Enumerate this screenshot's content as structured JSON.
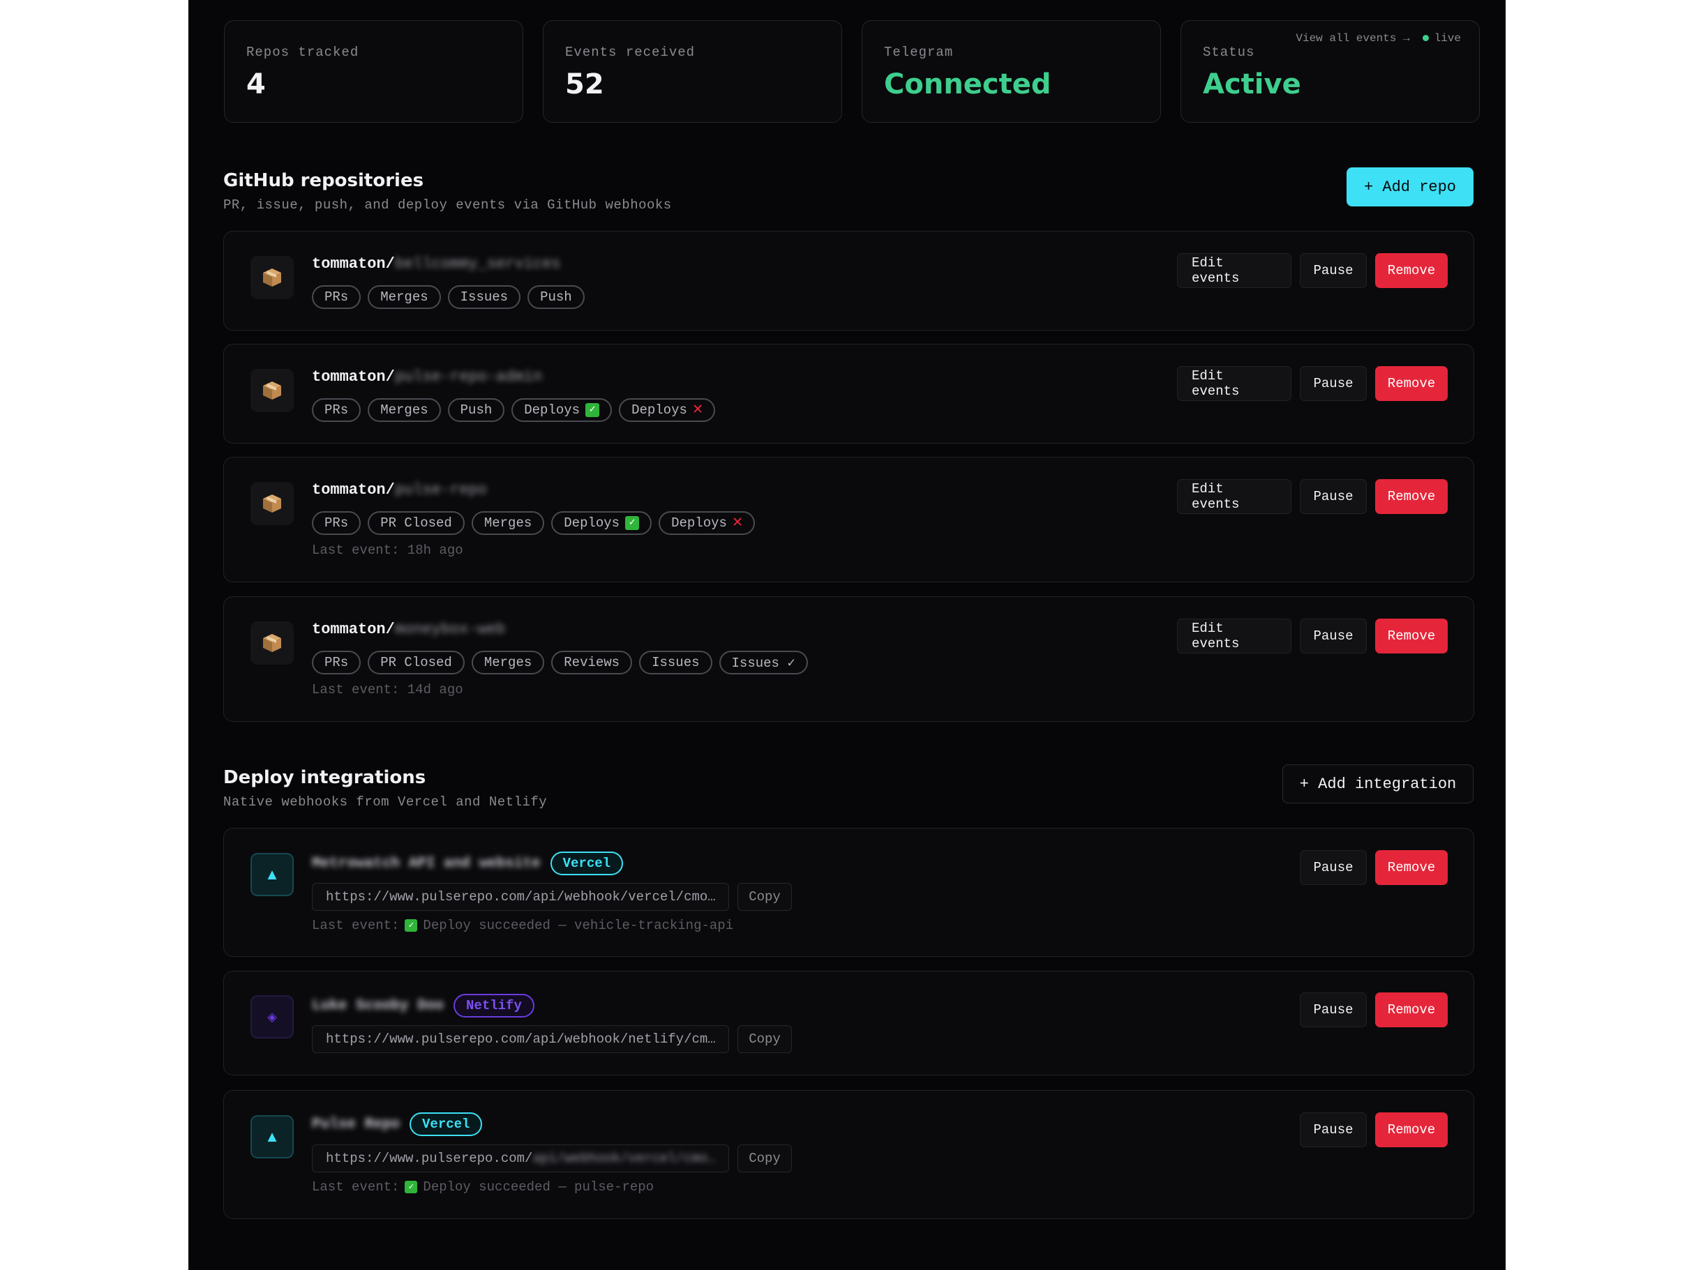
{
  "stats": [
    {
      "label": "Repos tracked",
      "value": "4",
      "accent": false
    },
    {
      "label": "Events received",
      "value": "52",
      "accent": false
    },
    {
      "label": "Telegram",
      "value": "Connected",
      "accent": true
    },
    {
      "label": "Status",
      "value": "Active",
      "accent": true
    }
  ],
  "status_link": {
    "view_all": "View all events →",
    "live": "live"
  },
  "github": {
    "title": "GitHub repositories",
    "subtitle": "PR, issue, push, and deploy events via GitHub webhooks",
    "add_label": "+ Add repo"
  },
  "repos": [
    {
      "owner": "tommaton/",
      "name": "bellcommy_services",
      "tags": [
        {
          "label": "PRs"
        },
        {
          "label": "Merges"
        },
        {
          "label": "Issues"
        },
        {
          "label": "Push"
        }
      ],
      "last_event": ""
    },
    {
      "owner": "tommaton/",
      "name": "pulse-repo-admin",
      "tags": [
        {
          "label": "PRs"
        },
        {
          "label": "Merges"
        },
        {
          "label": "Push"
        },
        {
          "label": "Deploys",
          "mark": "ok"
        },
        {
          "label": "Deploys",
          "mark": "bad"
        }
      ],
      "last_event": ""
    },
    {
      "owner": "tommaton/",
      "name": "pulse-repo",
      "tags": [
        {
          "label": "PRs"
        },
        {
          "label": "PR Closed"
        },
        {
          "label": "Merges"
        },
        {
          "label": "Deploys",
          "mark": "ok"
        },
        {
          "label": "Deploys",
          "mark": "bad"
        }
      ],
      "last_event": "Last event: 18h ago"
    },
    {
      "owner": "tommaton/",
      "name": "moneybox-web",
      "tags": [
        {
          "label": "PRs"
        },
        {
          "label": "PR Closed"
        },
        {
          "label": "Merges"
        },
        {
          "label": "Reviews"
        },
        {
          "label": "Issues"
        },
        {
          "label": "Issues ✓"
        }
      ],
      "last_event": "Last event: 14d ago"
    }
  ],
  "repo_actions": {
    "edit": "Edit events",
    "pause": "Pause",
    "remove": "Remove"
  },
  "deploy": {
    "title": "Deploy integrations",
    "subtitle": "Native webhooks from Vercel and Netlify",
    "add_label": "+ Add integration"
  },
  "integrations": [
    {
      "name": "Metrowatch API and website",
      "provider": "Vercel",
      "icon": "triangle-icon",
      "url_visible": "https://www.pulserepo.com/api/webhook/vercel/cmo…",
      "url_blurred": "",
      "last_event_prefix": "Last event:",
      "last_event_text": "Deploy succeeded — vehicle-tracking-api"
    },
    {
      "name": "Luke Scooby Doo",
      "provider": "Netlify",
      "icon": "diamond-icon",
      "url_visible": "https://www.pulserepo.com/api/webhook/netlify/cm…",
      "url_blurred": "",
      "last_event_prefix": "",
      "last_event_text": ""
    },
    {
      "name": "Pulse Repo",
      "provider": "Vercel",
      "icon": "triangle-icon",
      "url_visible": "https://www.pulserepo.com/",
      "url_blurred": "api/webhook/vercel/cmo…",
      "last_event_prefix": "Last event:",
      "last_event_text": "Deploy succeeded — pulse-repo"
    }
  ],
  "integration_actions": {
    "copy": "Copy",
    "pause": "Pause",
    "remove": "Remove"
  },
  "colors": {
    "accent_cyan": "#3ee0f5",
    "success_green": "#3ecf8e",
    "danger_red": "#e5263a",
    "netlify_purple": "#6a3be0"
  }
}
